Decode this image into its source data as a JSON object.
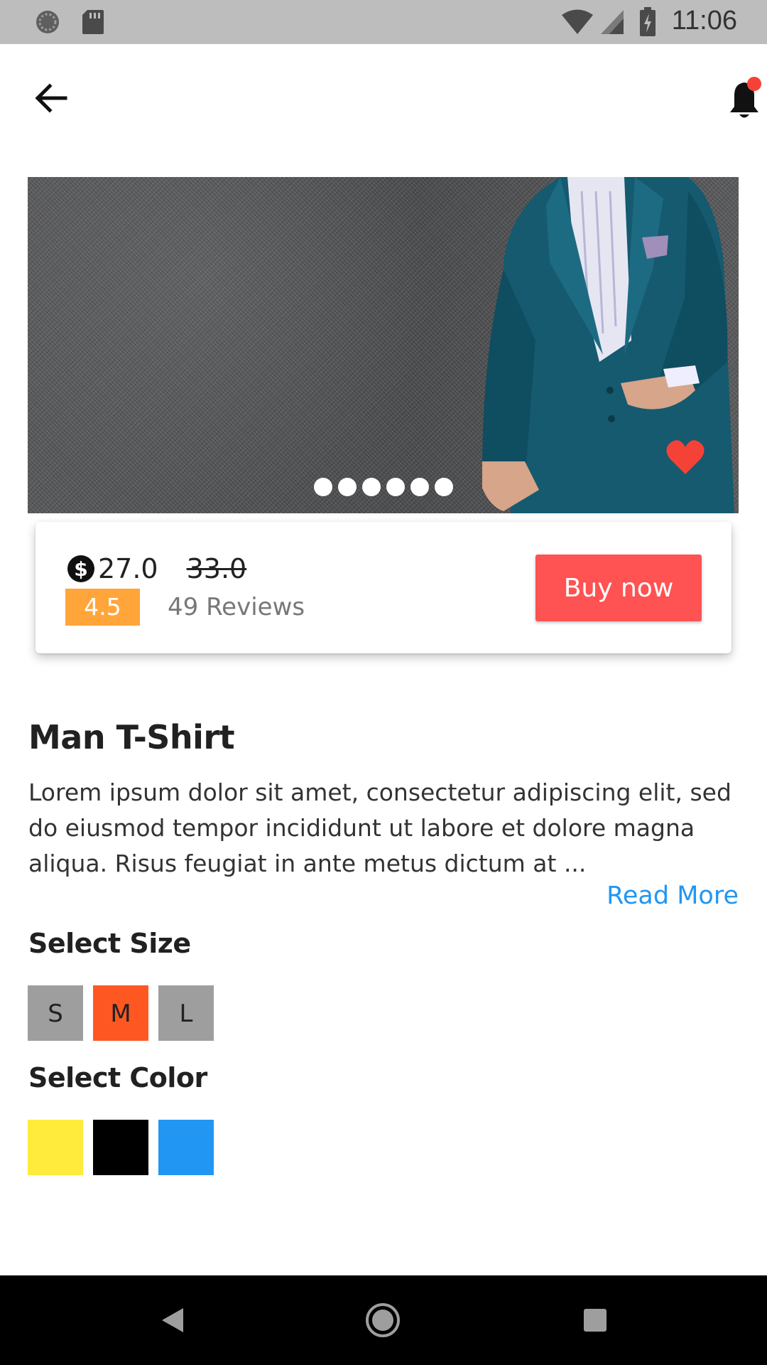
{
  "status_bar": {
    "time": "11:06",
    "icons": [
      "sync-icon",
      "sd-card-icon",
      "wifi-icon",
      "cell-signal-icon",
      "battery-charging-icon"
    ]
  },
  "app_bar": {
    "back_icon": "arrow-back-icon",
    "notification_icon": "bell-icon",
    "notification_dot_color": "#f44336"
  },
  "hero": {
    "carousel_dots": 6,
    "favorite_icon": "heart-icon",
    "favorite_color": "#f44336"
  },
  "pricing": {
    "currency_icon": "dollar-icon",
    "price": "27.0",
    "old_price": "33.0",
    "rating": "4.5",
    "reviews": "49 Reviews",
    "buy_label": "Buy now"
  },
  "product": {
    "title": "Man T-Shirt",
    "description": "Lorem ipsum dolor sit amet, consectetur adipiscing elit, sed do eiusmod tempor incididunt ut labore et dolore magna aliqua. Risus feugiat in ante metus dictum at ...",
    "read_more": "Read More"
  },
  "size": {
    "label": "Select Size",
    "options": [
      "S",
      "M",
      "L"
    ],
    "selected": "M"
  },
  "color": {
    "label": "Select Color",
    "options": [
      "#ffeb3b",
      "#000000",
      "#2196f3"
    ]
  },
  "colors": {
    "accent": "#ff5252",
    "rating": "#ffa53a",
    "selected_size": "#ff5722",
    "link": "#2196f3"
  },
  "nav_bar": {
    "icons": [
      "back-triangle-icon",
      "home-circle-icon",
      "recents-square-icon"
    ]
  }
}
